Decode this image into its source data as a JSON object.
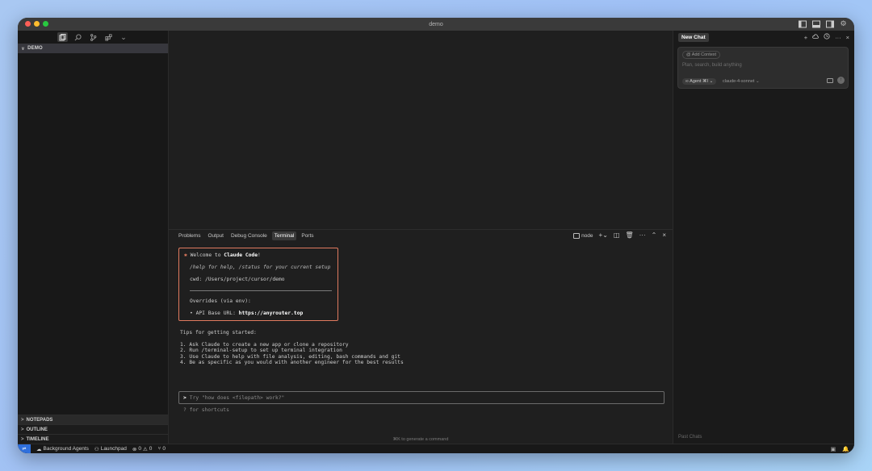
{
  "window": {
    "title": "demo"
  },
  "traffic_lights": {
    "close_color": "#ff5f57",
    "minimize_color": "#febc2e",
    "zoom_color": "#28c840"
  },
  "sidebar": {
    "project": "DEMO",
    "bottom_sections": [
      "NOTEPADS",
      "OUTLINE",
      "TIMELINE"
    ]
  },
  "panel": {
    "tabs": [
      "Problems",
      "Output",
      "Debug Console",
      "Terminal",
      "Ports"
    ],
    "active_tab": "Terminal",
    "shell": "node"
  },
  "terminal": {
    "welcome_prefix": "Welcome to ",
    "welcome_brand": "Claude Code",
    "welcome_suffix": "!",
    "help_line": "/help for help, /status for your current setup",
    "cwd_line": "cwd: /Users/project/cursor/demo",
    "overrides_line": "Overrides (via env):",
    "api_label": "• API Base URL: ",
    "api_url": "https://anyrouter.top",
    "tips_title": "Tips for getting started:",
    "tips": [
      "1. Ask Claude to create a new app or clone a repository",
      "2. Run /terminal-setup to set up terminal integration",
      "3. Use Claude to help with file analysis, editing, bash commands and git",
      "4. Be as specific as you would with another engineer for the best results"
    ],
    "prompt_caret": ">",
    "prompt_placeholder": "Try \"how does <filepath> work?\"",
    "shortcuts_hint": "? for shortcuts"
  },
  "editor": {
    "cmdk_hint": "⌘K to generate a command"
  },
  "chat": {
    "tab_label": "New Chat",
    "add_context": "@ Add Context",
    "placeholder": "Plan, search, build anything",
    "agent_label": "∞ Agent ⌘I ⌄",
    "model": "claude-4-sonnet ⌄",
    "past_chats": "Past Chats"
  },
  "statusbar": {
    "background_agents": "Background Agents",
    "launchpad": "Launchpad",
    "errors": "0",
    "warnings": "0",
    "ports": "0"
  },
  "colors": {
    "accent_orange": "#e07a5f",
    "remote_blue": "#2f6fdc"
  }
}
